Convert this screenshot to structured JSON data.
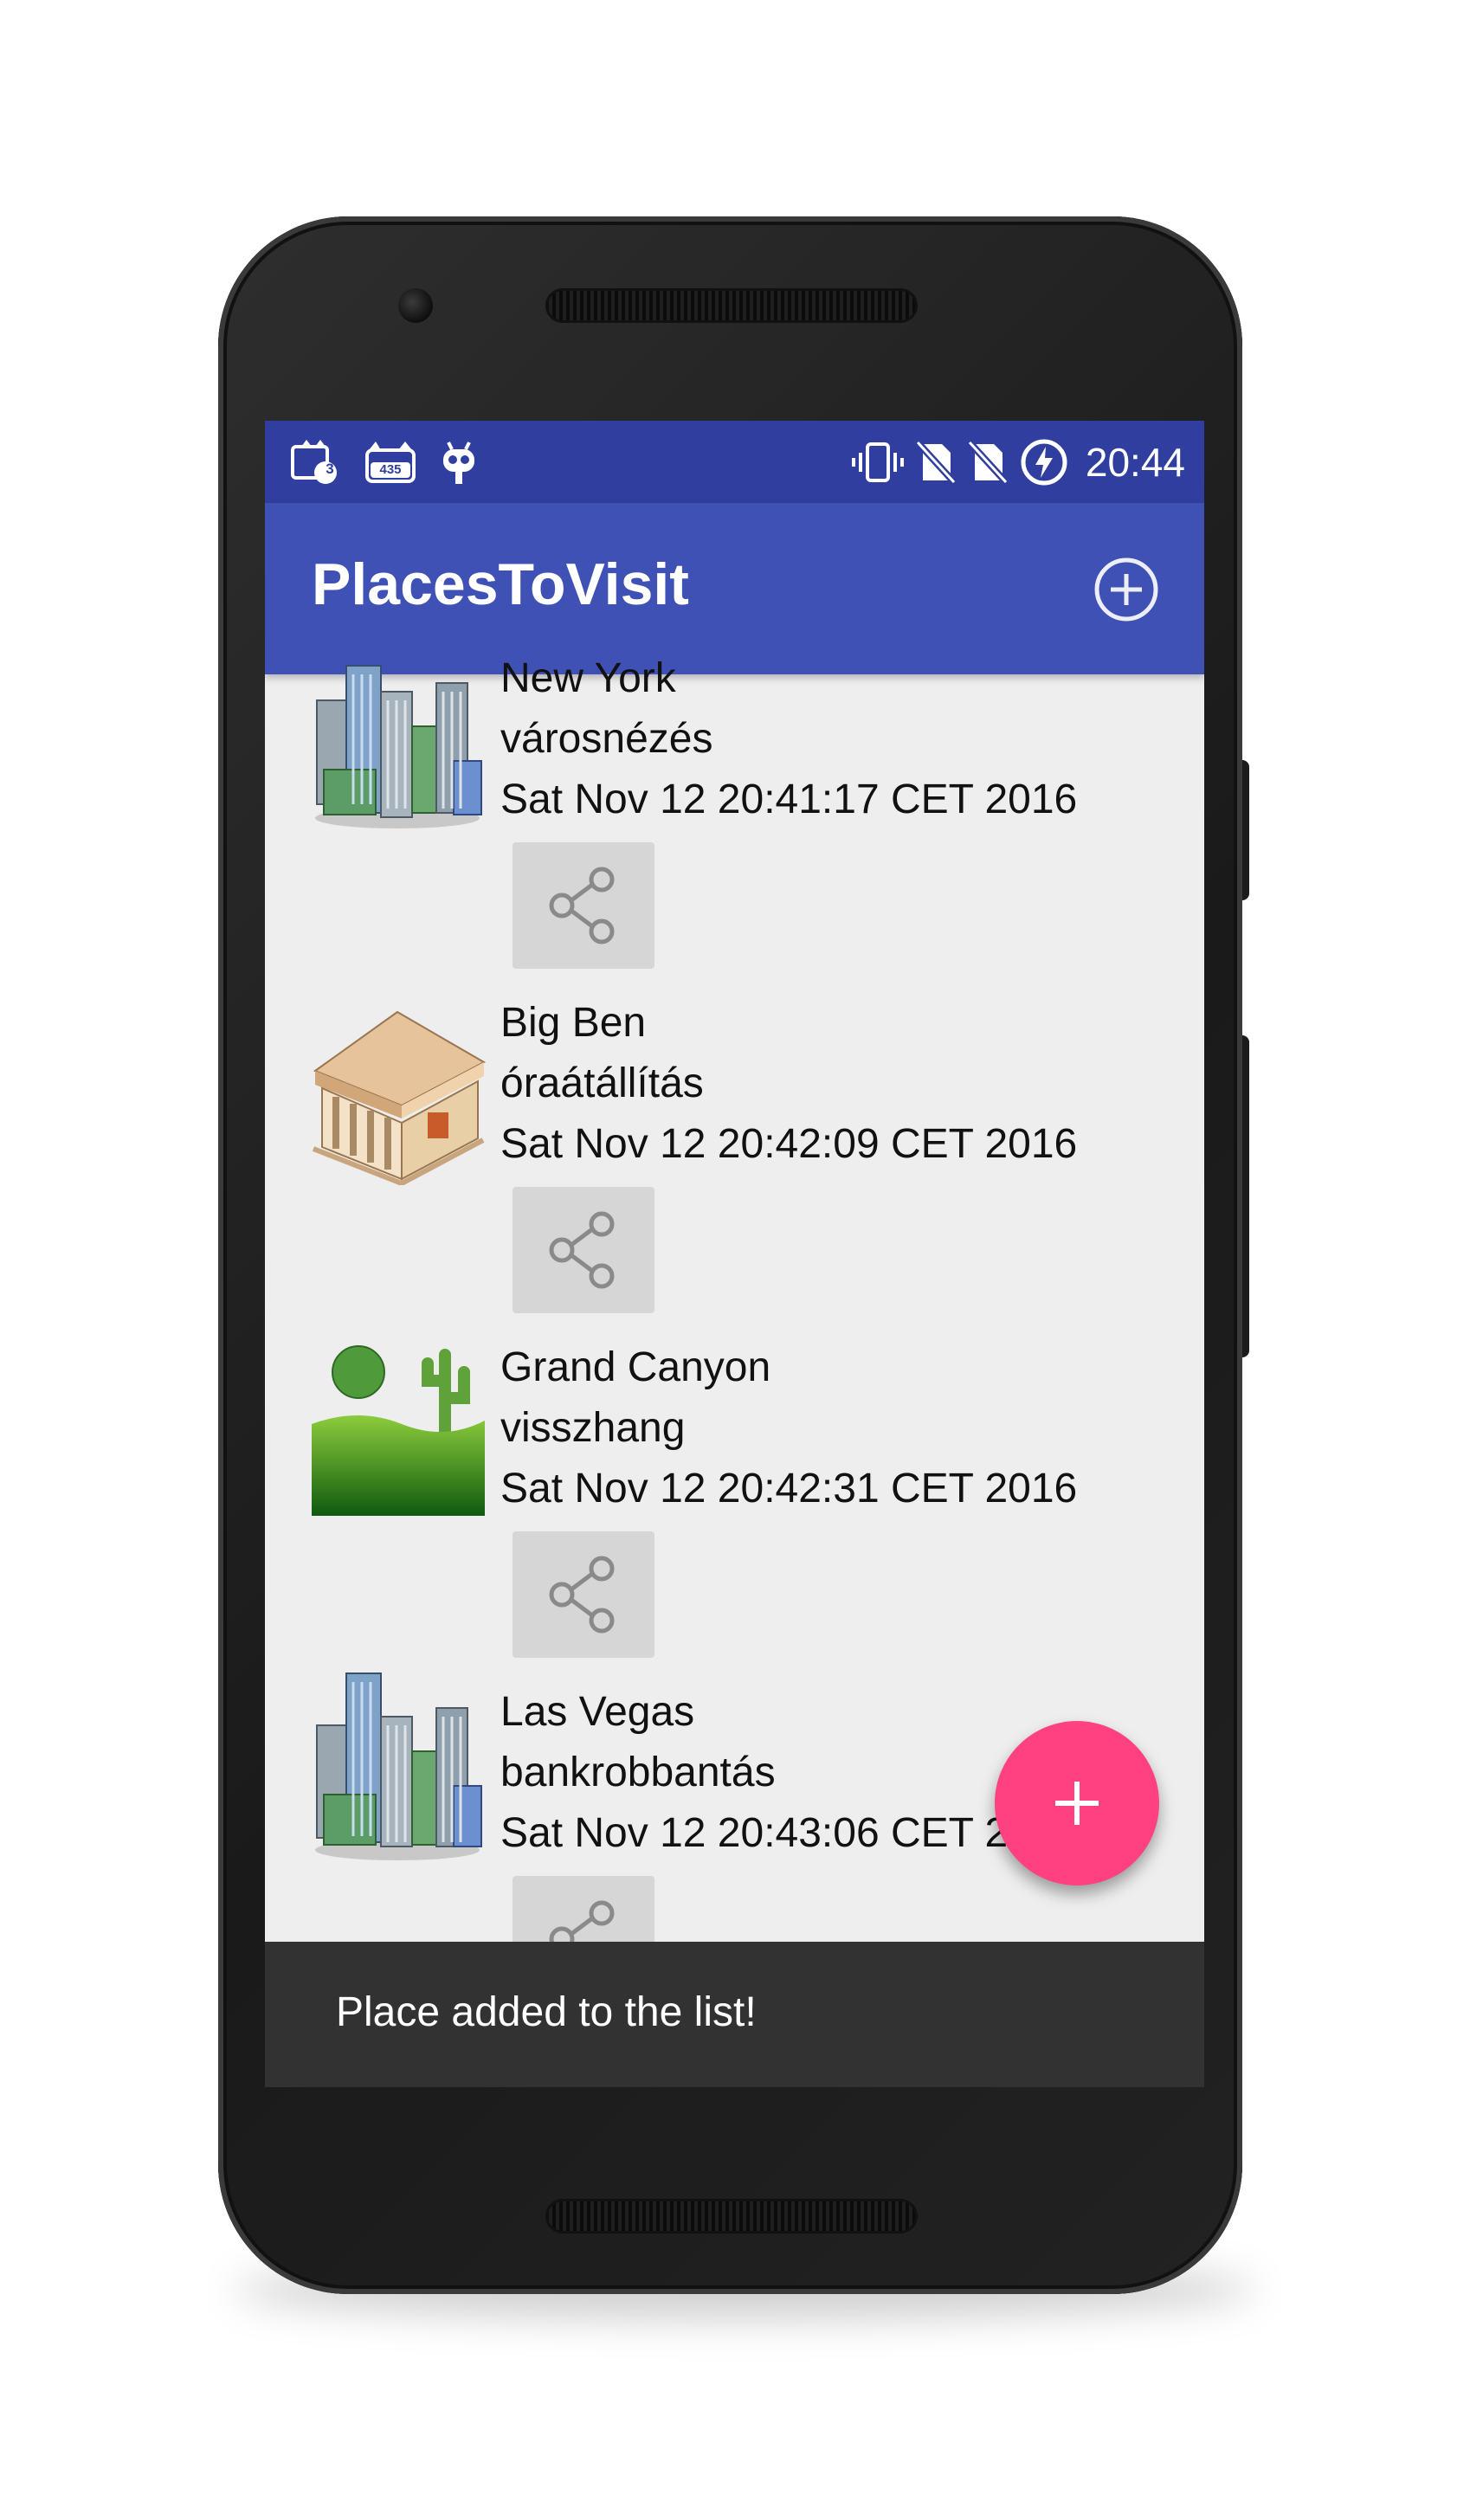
{
  "status_bar": {
    "notif_badge_1": "3",
    "notif_badge_2": "435",
    "time": "20:44"
  },
  "app_bar": {
    "title": "PlacesToVisit",
    "add_icon": "add-circle-icon"
  },
  "places": [
    {
      "name": "New York",
      "description": "városnézés",
      "date": "Sat Nov 12 20:41:17 CET 2016",
      "icon": "city-buildings-icon"
    },
    {
      "name": "Big Ben",
      "description": "óraátállítás",
      "date": "Sat Nov 12 20:42:09 CET 2016",
      "icon": "monument-building-icon"
    },
    {
      "name": "Grand Canyon",
      "description": "visszhang",
      "date": "Sat Nov 12 20:42:31 CET 2016",
      "icon": "desert-landscape-icon"
    },
    {
      "name": "Las Vegas",
      "description": "bankrobbantás",
      "date": "Sat Nov 12 20:43:06 CET 2016",
      "icon": "city-buildings-icon"
    }
  ],
  "share_icon": "share-icon",
  "fab": {
    "icon": "plus-icon"
  },
  "snackbar": {
    "message": "Place added to the list!"
  },
  "colors": {
    "status_bar": "#303f9f",
    "app_bar": "#3f51b5",
    "fab": "#ff4081",
    "list_background": "#eeeeee",
    "snackbar": "#323232"
  }
}
